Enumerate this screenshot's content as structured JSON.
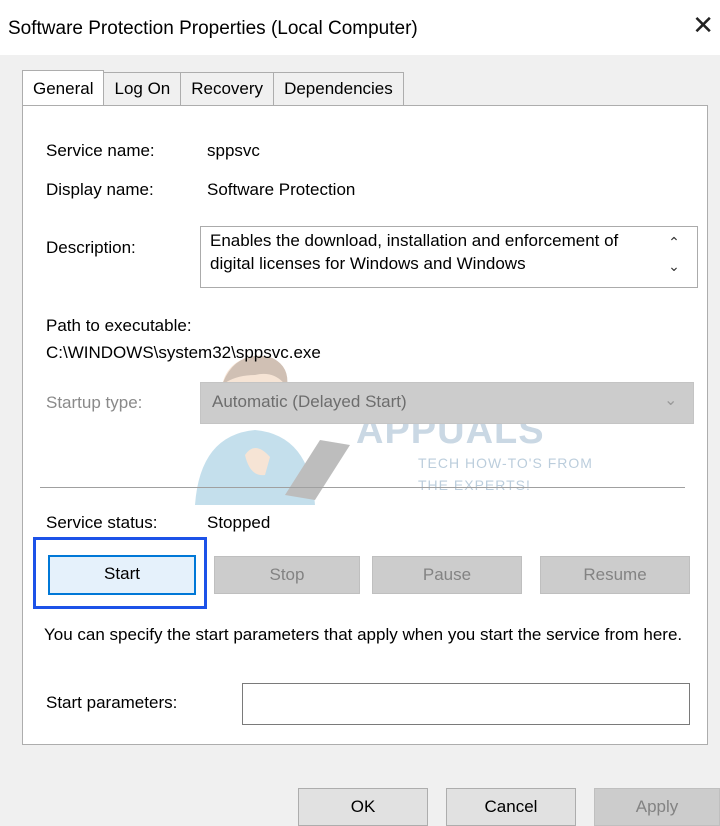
{
  "window": {
    "title": "Software Protection Properties (Local Computer)"
  },
  "tabs": [
    {
      "label": "General"
    },
    {
      "label": "Log On"
    },
    {
      "label": "Recovery"
    },
    {
      "label": "Dependencies"
    }
  ],
  "general": {
    "service_name_label": "Service name:",
    "service_name_value": "sppsvc",
    "display_name_label": "Display name:",
    "display_name_value": "Software Protection",
    "description_label": "Description:",
    "description_value": "Enables the download, installation and enforcement of digital licenses for Windows and Windows",
    "path_label": "Path to executable:",
    "path_value": "C:\\WINDOWS\\system32\\sppsvc.exe",
    "startup_type_label": "Startup type:",
    "startup_type_value": "Automatic (Delayed Start)",
    "service_status_label": "Service status:",
    "service_status_value": "Stopped",
    "buttons": {
      "start": "Start",
      "stop": "Stop",
      "pause": "Pause",
      "resume": "Resume"
    },
    "info_text": "You can specify the start parameters that apply when you start the service from here.",
    "start_parameters_label": "Start parameters:",
    "start_parameters_value": ""
  },
  "footer": {
    "ok": "OK",
    "cancel": "Cancel",
    "apply": "Apply"
  },
  "watermark": {
    "brand": "APPUALS",
    "tagline1": "TECH HOW-TO'S FROM",
    "tagline2": "THE EXPERTS!"
  },
  "icons": {
    "close": "close-icon",
    "scroll_up": "chevron-up-icon",
    "scroll_down": "chevron-down-icon",
    "dropdown": "chevron-down-icon"
  },
  "colors": {
    "focus_highlight": "#1d52e8",
    "focused_button_border": "#0078d7"
  }
}
